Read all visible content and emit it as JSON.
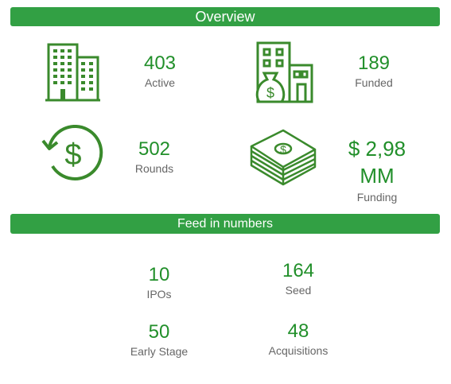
{
  "overview": {
    "title": "Overview",
    "stats": [
      {
        "value": "403",
        "label": "Active",
        "icon": "office-building-icon"
      },
      {
        "value": "189",
        "label": "Funded",
        "icon": "building-money-bag-icon"
      },
      {
        "value": "502",
        "label": "Rounds",
        "icon": "refresh-dollar-icon"
      },
      {
        "value_line1": "$ 2,98",
        "value_line2": "MM",
        "label": "Funding",
        "icon": "cash-stack-icon"
      }
    ]
  },
  "feed": {
    "title": "Feed in numbers",
    "stats": [
      {
        "value": "10",
        "label": "IPOs"
      },
      {
        "value": "164",
        "label": "Seed"
      },
      {
        "value": "50",
        "label": "Early Stage"
      },
      {
        "value": "48",
        "label": "Acquisitions"
      }
    ]
  },
  "colors": {
    "accent": "#32a044",
    "value_text": "#218f2a",
    "label_text": "#666666"
  }
}
